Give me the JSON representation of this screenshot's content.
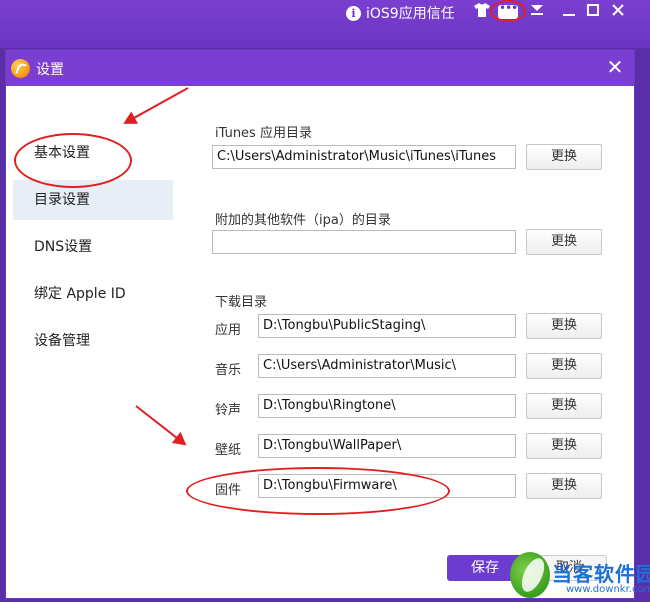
{
  "topbar": {
    "trust_label": "iOS9应用信任",
    "icons": [
      "info-icon",
      "tshirt-icon",
      "message-icon",
      "download-icon",
      "minimize-icon",
      "maximize-icon",
      "close-icon"
    ]
  },
  "dialog": {
    "title": "设置",
    "close_glyph": "✕"
  },
  "sidebar": {
    "items": [
      {
        "label": "基本设置"
      },
      {
        "label": "目录设置"
      },
      {
        "label": "DNS设置"
      },
      {
        "label": "绑定 Apple ID"
      },
      {
        "label": "设备管理"
      }
    ]
  },
  "content": {
    "itunes": {
      "label": "iTunes 应用目录",
      "path": "C:\\Users\\Administrator\\Music\\iTunes\\iTunes",
      "button": "更换"
    },
    "ipa": {
      "label": "附加的其他软件（ipa）的目录",
      "path": "",
      "button": "更换"
    },
    "download": {
      "label": "下载目录",
      "rows": [
        {
          "label": "应用",
          "path": "D:\\Tongbu\\PublicStaging\\",
          "button": "更换"
        },
        {
          "label": "音乐",
          "path": "C:\\Users\\Administrator\\Music\\",
          "button": "更换"
        },
        {
          "label": "铃声",
          "path": "D:\\Tongbu\\Ringtone\\",
          "button": "更换"
        },
        {
          "label": "壁纸",
          "path": "D:\\Tongbu\\WallPaper\\",
          "button": "更换"
        },
        {
          "label": "固件",
          "path": "D:\\Tongbu\\Firmware\\",
          "button": "更换"
        }
      ]
    }
  },
  "footer": {
    "save_label": "保存",
    "cancel_label": "取消"
  },
  "watermark": {
    "name": "当客软件园",
    "url": "www.downkr.com"
  },
  "colors": {
    "brand_purple": "#6a35c2",
    "annotation_red": "#e02020"
  }
}
